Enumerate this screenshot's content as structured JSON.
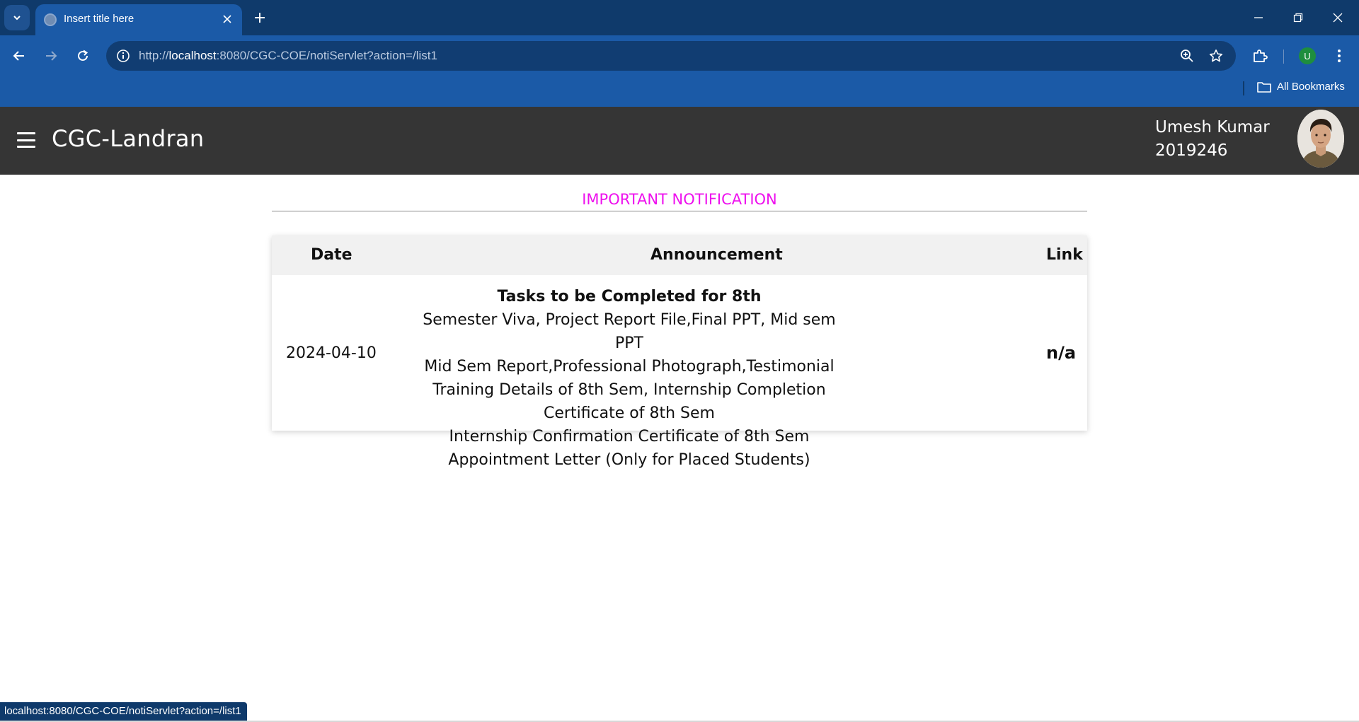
{
  "browser": {
    "tab_title": "Insert title here",
    "url_prefix": "http://",
    "url_host": "localhost",
    "url_rest": ":8080/CGC-COE/notiServlet?action=/list1",
    "bookmarks_label": "All Bookmarks",
    "profile_initial": "U",
    "status_url": "localhost:8080/CGC-COE/notiServlet?action=/list1"
  },
  "header": {
    "brand": "CGC-Landran",
    "user_name": "Umesh Kumar",
    "user_id": "2019246"
  },
  "notifications": {
    "title": "IMPORTANT NOTIFICATION",
    "columns": {
      "date": "Date",
      "announcement": "Announcement",
      "link": "Link"
    },
    "rows": [
      {
        "date": "2024-04-10",
        "headline": "Tasks to be Completed for 8th",
        "lines": [
          "Semester Viva, Project Report File,Final PPT, Mid sem PPT",
          "Mid Sem Report,Professional Photograph,Testimonial",
          "Training Details of 8th Sem, Internship Completion Certificate of 8th Sem",
          "Internship Confirmation Certificate of 8th Sem",
          "Appointment Letter (Only for Placed Students)"
        ],
        "link": "n/a"
      }
    ]
  },
  "colors": {
    "browser_frame": "#0f3a6b",
    "browser_toolbar": "#1b5aa7",
    "header_bg": "#353535",
    "notification_title": "#ee10ee",
    "table_head_bg": "#f1f1f1"
  }
}
